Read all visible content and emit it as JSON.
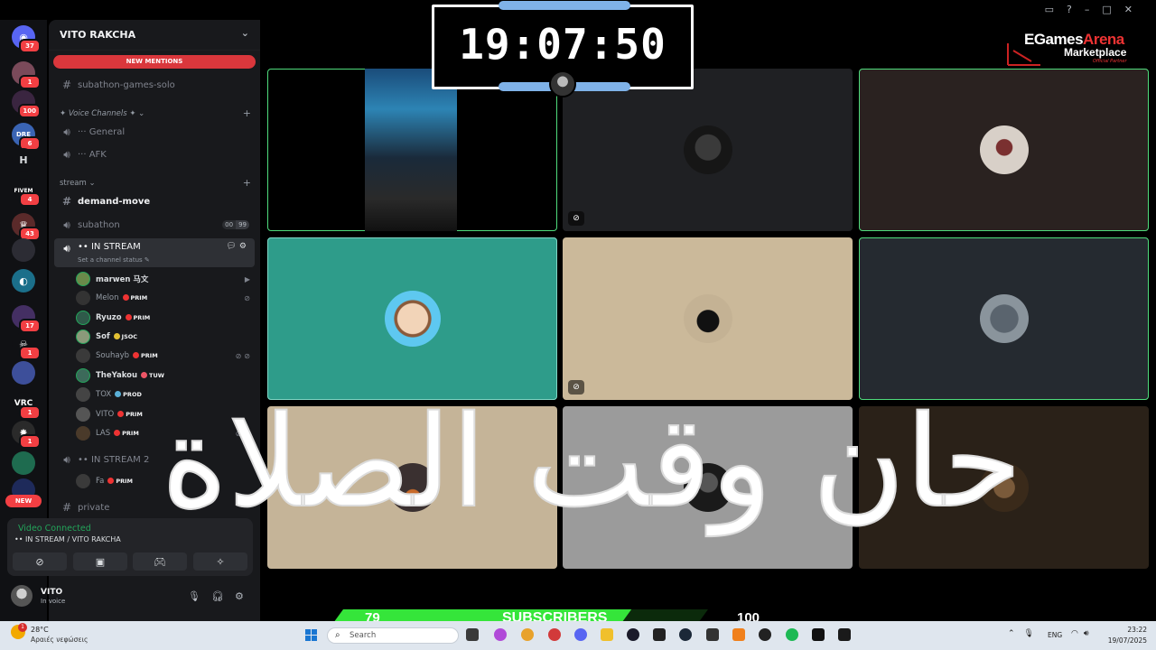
{
  "server_rail": {
    "badges": [
      "37",
      "1",
      "100",
      "6",
      "4",
      "43",
      "17",
      "1",
      "1",
      "1"
    ],
    "letters": {
      "h": "H",
      "fivem": "FIVEM",
      "dre": "DRE",
      "vrc": "VRC"
    },
    "new_label": "NEW"
  },
  "sidebar": {
    "guild_name": "VITO RAKCHA",
    "new_mentions": "NEW MENTIONS",
    "text_channel_1": "subathon-games-solo",
    "voice_category": "✦ Voice Channels ✦ ⌄",
    "general": "··· General",
    "afk": "··· AFK",
    "stream_category": "stream ⌄",
    "demand_move": "demand-move",
    "subathon": "subathon",
    "subathon_counts": [
      "00",
      "99"
    ],
    "in_stream": "•• IN STREAM",
    "channel_status": "Set a channel status ✎",
    "in_stream_2": "•• IN STREAM 2",
    "private": "private",
    "users": [
      {
        "name": "marwen 马文",
        "tag": ""
      },
      {
        "name": "Melon",
        "tag": "PRIM"
      },
      {
        "name": "Ryuzo",
        "tag": "PRIM"
      },
      {
        "name": "Sof",
        "tag": "JSOC"
      },
      {
        "name": "Souhayb",
        "tag": "PRIM"
      },
      {
        "name": "TheYakou",
        "tag": "TUW"
      },
      {
        "name": "TOX",
        "tag": "PROD"
      },
      {
        "name": "VITO",
        "tag": "PRIM"
      },
      {
        "name": "LAS",
        "tag": "PRIM"
      },
      {
        "name": "Fa",
        "tag": "PRIM"
      }
    ]
  },
  "voice_panel": {
    "status": "Video Connected",
    "channel": "•• IN STREAM / VITO RAKCHA"
  },
  "user_panel": {
    "name": "VITO",
    "status": "In voice"
  },
  "timer": "19:07:50",
  "logo": {
    "main_a": "EGames",
    "main_b": "Arena",
    "sub": "Marketplace",
    "tag": "Official Partner"
  },
  "overlay_arabic": "حان وقت الصلاة",
  "subscribers": {
    "current": "79",
    "label": "SUBSCRIBERS",
    "goal": "100",
    "progress_fraction": 0.79
  },
  "taskbar": {
    "temp": "28°C",
    "condition": "Αραιές νεφώσεις",
    "weather_badge": "1",
    "search_placeholder": "Search",
    "lang": "ENG",
    "time": "23:22",
    "date": "19/07/2025"
  },
  "colors": {
    "speaking": "#4fdc7c",
    "mention": "#da373c",
    "sub_bar": "#35e53a",
    "tile_teal": "#2e9c8a",
    "tile_tan": "#cbb99a"
  }
}
